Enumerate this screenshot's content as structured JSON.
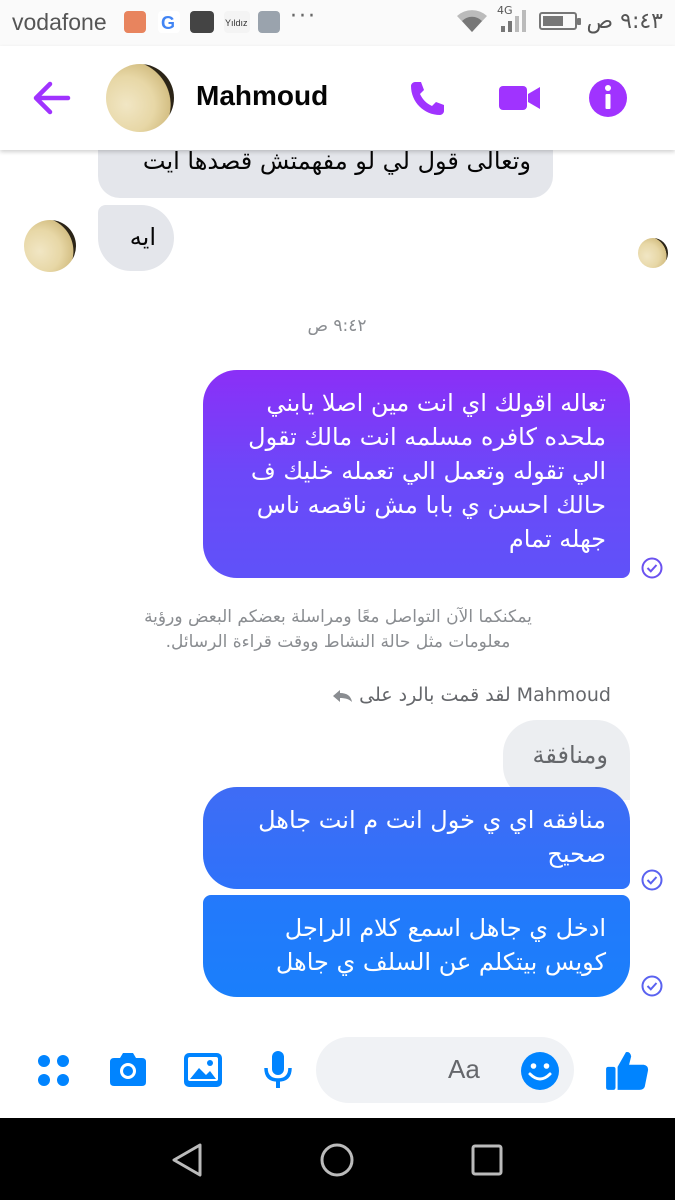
{
  "status_bar": {
    "carrier": "vodafone",
    "network": "4G",
    "time": "٩:٤٣ ص",
    "battery_level": 0.6,
    "notification_icons": [
      "email-icon",
      "google-icon",
      "photo-app-icon",
      "yildiz-app-icon",
      "gallery-icon"
    ],
    "more": "···"
  },
  "header": {
    "contact_name": "Mahmoud",
    "icons": [
      "back-arrow-icon",
      "phone-icon",
      "video-icon",
      "info-icon"
    ],
    "accent_color": "#a033ff"
  },
  "messages": {
    "incoming_1": "وتعالى قول لي لو مفهمتش قصدها ايت",
    "incoming_2": "ايه",
    "timestamp": "٩:٤٢ ص",
    "outgoing_1": {
      "line1": "تعاله اقولك اي انت مين اصلا يابني",
      "line2": "ملحده كافره مسلمه انت مالك تقول",
      "line3": "الي تقوله وتعمل الي تعمله خليك ف",
      "line4": "حالك احسن ي بابا مش ناقصه ناس",
      "line5": "جهله تمام"
    },
    "system_notice": {
      "line1": "يمكنكما الآن التواصل معًا ومراسلة بعضكم البعض ورؤية",
      "line2": "معلومات مثل حالة النشاط ووقت قراءة الرسائل."
    },
    "reply_label": {
      "name": "Mahmoud",
      "text": "لقد قمت بالرد على"
    },
    "quoted_reply": "ومنافقة",
    "outgoing_2": {
      "line1": "منافقه اي ي خول انت م انت جاهل",
      "line2": "صحيح"
    },
    "outgoing_3": {
      "line1": "ادخل ي جاهل اسمع كلام الراجل",
      "line2": "كويس بيتكلم عن السلف ي جاهل"
    }
  },
  "composer": {
    "placeholder": "Aa",
    "icons": [
      "menu-dots-icon",
      "camera-icon",
      "gallery-icon",
      "microphone-icon",
      "emoji-icon",
      "like-icon"
    ],
    "accent_color": "#0084ff"
  },
  "navbar": {
    "icons": [
      "back-triangle-icon",
      "home-circle-icon",
      "recents-square-icon"
    ]
  }
}
